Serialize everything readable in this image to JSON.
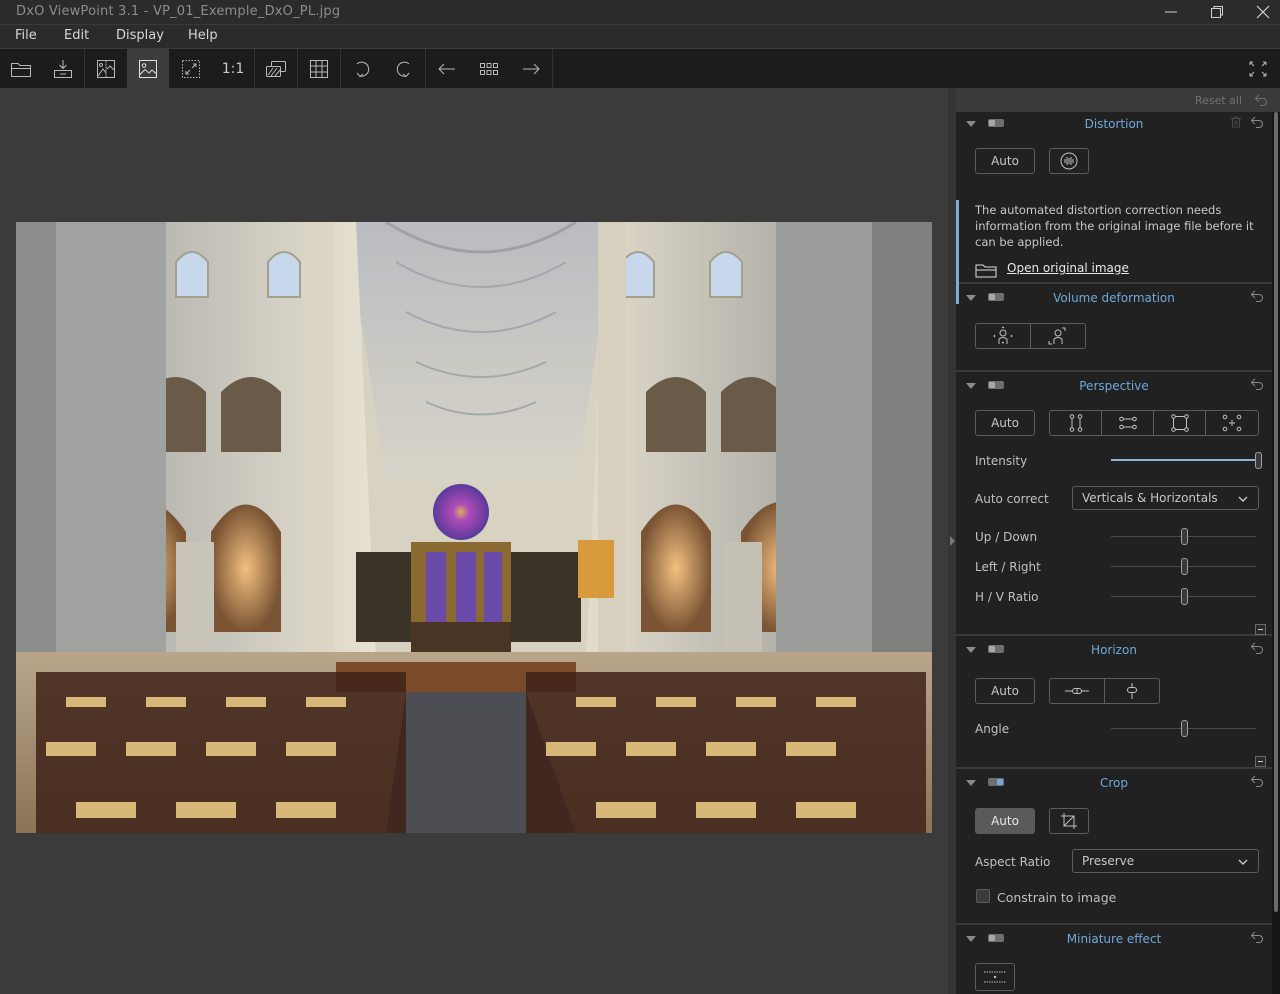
{
  "window": {
    "title": "DxO ViewPoint 3.1 - VP_01_Exemple_DxO_PL.jpg",
    "controls": [
      "minimize",
      "restore",
      "close"
    ]
  },
  "menu": {
    "items": [
      {
        "label": "File",
        "mnemonic": "i"
      },
      {
        "label": "Edit",
        "mnemonic": "E"
      },
      {
        "label": "Display",
        "mnemonic": "D"
      },
      {
        "label": "Help",
        "mnemonic": "l"
      }
    ]
  },
  "toolbar": {
    "buttons": [
      {
        "icon": "open-folder-icon"
      },
      {
        "icon": "export-icon"
      },
      {
        "icon": "before-after-icon"
      },
      {
        "icon": "image-view-icon",
        "active": true
      },
      {
        "icon": "fit-to-screen-icon"
      },
      {
        "icon": "zoom-1-1",
        "label": "1:1"
      },
      {
        "icon": "overlay-icon"
      },
      {
        "icon": "grid-icon"
      },
      {
        "icon": "rotate-left-icon"
      },
      {
        "icon": "rotate-right-icon"
      },
      {
        "icon": "previous-icon"
      },
      {
        "icon": "thumbnails-icon"
      },
      {
        "icon": "next-icon"
      }
    ],
    "fullscreen_icon": "fullscreen-icon"
  },
  "panel": {
    "reset_all": "Reset all",
    "distortion": {
      "title": "Distortion",
      "enabled": false,
      "auto_label": "Auto",
      "info_message": "The automated distortion correction needs information from the original image file before it can be applied.",
      "open_link": "Open original image"
    },
    "volume_deformation": {
      "title": "Volume deformation",
      "enabled": false
    },
    "perspective": {
      "title": "Perspective",
      "enabled": false,
      "auto_label": "Auto",
      "intensity_label": "Intensity",
      "intensity_value": 1.0,
      "auto_correct_label": "Auto correct",
      "auto_correct_value": "Verticals & Horizontals",
      "sliders": [
        {
          "label": "Up / Down",
          "value": 0.5
        },
        {
          "label": "Left / Right",
          "value": 0.5
        },
        {
          "label": "H / V Ratio",
          "value": 0.5
        }
      ]
    },
    "horizon": {
      "title": "Horizon",
      "enabled": false,
      "auto_label": "Auto",
      "angle_label": "Angle",
      "angle_value": 0.5
    },
    "crop": {
      "title": "Crop",
      "enabled": true,
      "auto_label": "Auto",
      "auto_pressed": true,
      "aspect_ratio_label": "Aspect Ratio",
      "aspect_ratio_value": "Preserve",
      "constrain_label": "Constrain to image",
      "constrain_checked": false
    },
    "miniature": {
      "title": "Miniature effect",
      "enabled": false
    }
  },
  "colors": {
    "accent": "#6fa8dc",
    "panel_bg": "#212121",
    "canvas_bg": "#3b3b3b",
    "toolbar_bg": "#1c1c1c"
  }
}
